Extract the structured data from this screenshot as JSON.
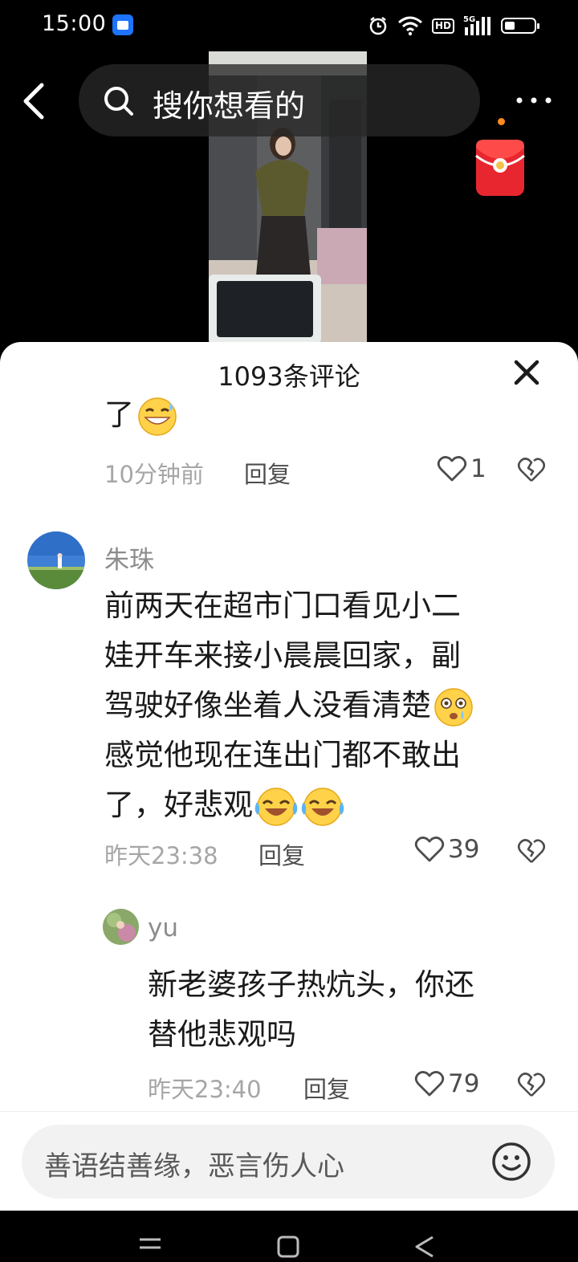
{
  "status_bar": {
    "time": "15:00",
    "network": "5G",
    "hd_label": "HD",
    "battery_level": 0.35
  },
  "header": {
    "search_placeholder": "搜你想看的"
  },
  "comments_panel": {
    "title": "1093条评论",
    "comments": [
      {
        "text": "了",
        "emoji_names": [
          "grin-sweat-emoji"
        ],
        "time": "10分钟前",
        "reply_label": "回复",
        "likes": "1"
      },
      {
        "username": "朱珠",
        "text_lines": [
          "前两天在超市门口看见小二",
          "娃开车来接小晨晨回家，副",
          "驾驶好像坐着人没看清楚",
          "感觉他现在连出门都不敢出",
          "了，好悲观"
        ],
        "emoji_names": [
          "flushed-tear-emoji",
          "rolling-laugh-emoji",
          "rolling-laugh-emoji"
        ],
        "time": "昨天23:38",
        "reply_label": "回复",
        "likes": "39"
      },
      {
        "username": "yu",
        "text_lines": [
          "新老婆孩子热炕头，你还",
          "替他悲观吗"
        ],
        "time": "昨天23:40",
        "reply_label": "回复",
        "likes": "79"
      }
    ]
  },
  "input": {
    "placeholder": "善语结善缘，恶言伤人心"
  },
  "colors": {
    "accent_dot": "#ff8a1f",
    "red_packet": "#e8262f",
    "meta_gray": "#a6a6a6"
  }
}
